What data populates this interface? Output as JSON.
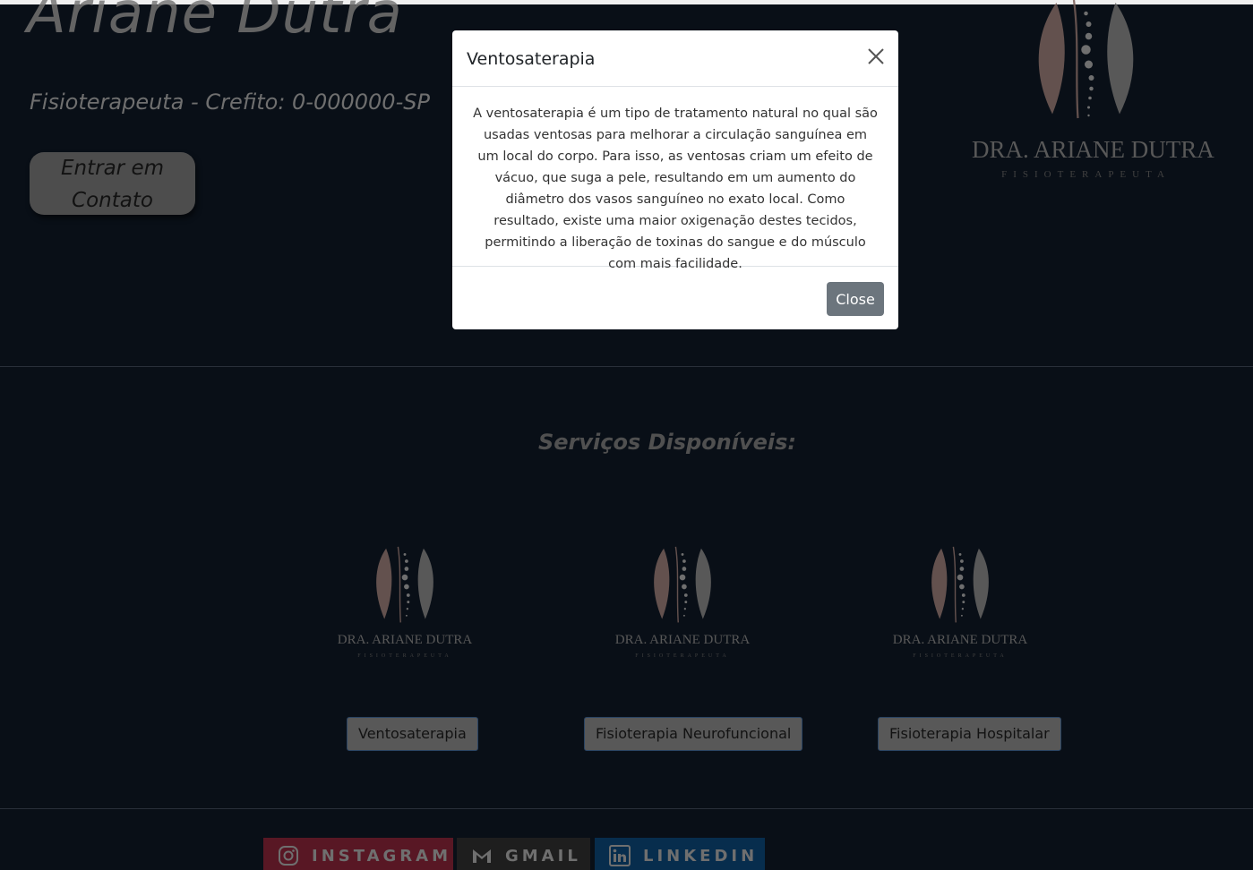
{
  "hero": {
    "name": "Ariane Dutra",
    "subtitle": "Fisioterapeuta - Crefito: 0-000000-SP",
    "contact_button": "Entrar em Contato"
  },
  "logo": {
    "name": "DRA. ARIANE DUTRA",
    "subtitle": "FISIOTERAPEUTA"
  },
  "services": {
    "title": "Serviços Disponíveis:",
    "items": [
      {
        "label": "Ventosaterapia"
      },
      {
        "label": "Fisioterapia Neurofuncional"
      },
      {
        "label": "Fisioterapia Hospitalar"
      }
    ]
  },
  "social": [
    {
      "label": "INSTAGRAM",
      "icon": "instagram-icon",
      "color": "#7a2033"
    },
    {
      "label": "GMAIL",
      "icon": "gmail-icon",
      "color": "#2a2a2a"
    },
    {
      "label": "LINKEDIN",
      "icon": "linkedin-icon",
      "color": "#0a3f6b"
    }
  ],
  "modal": {
    "title": "Ventosaterapia",
    "body": "A ventosaterapia é um tipo de tratamento natural no qual são usadas ventosas para melhorar a circulação sanguínea em um local do corpo. Para isso, as ventosas criam um efeito de vácuo, que suga a pele, resultando em um aumento do diâmetro dos vasos sanguíneo no exato local. Como resultado, existe uma maior oxigenação destes tecidos, permitindo a liberação de toxinas do sangue e do músculo com mais facilidade.",
    "close_button": "Close"
  },
  "colors": {
    "background": "#0d1520",
    "logo_leaf_left": "#8a716c",
    "logo_leaf_right": "#7a7a7a",
    "close_button": "#6c757d"
  }
}
